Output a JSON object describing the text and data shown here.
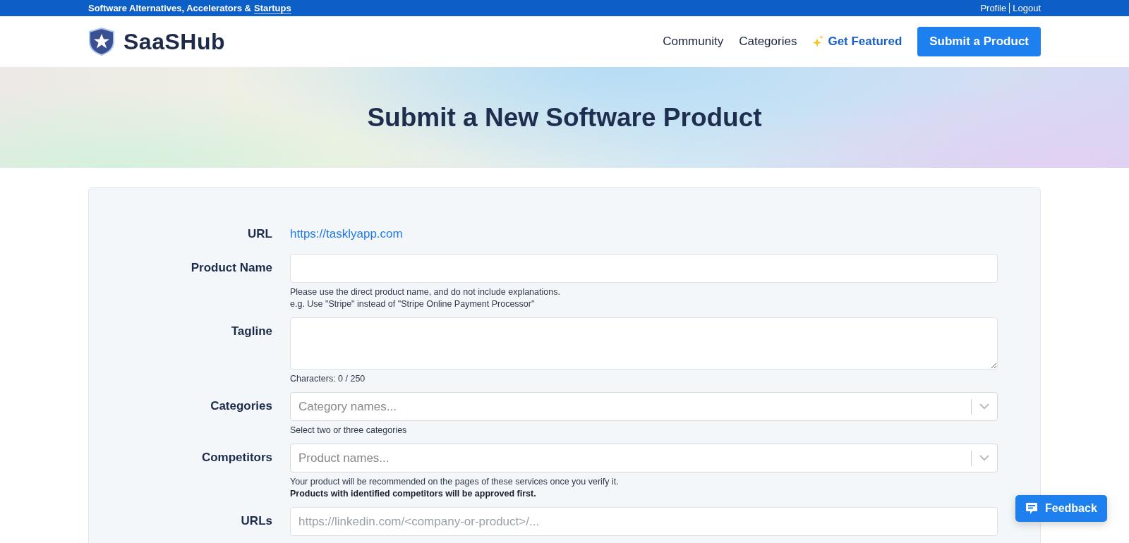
{
  "top_bar": {
    "tagline": "Software Alternatives, Accelerators &",
    "tagline_link": "Startups",
    "user_links": [
      "Profile",
      "Logout"
    ]
  },
  "nav": {
    "logo": "SaaSHub",
    "links": [
      {
        "label": "Community",
        "kind": "plain"
      },
      {
        "label": "Categories",
        "kind": "plain"
      },
      {
        "label": "Get Featured",
        "kind": "featured"
      },
      {
        "label": "Submit a Product",
        "kind": "button"
      }
    ]
  },
  "hero": {
    "title": "Submit a New Software Product"
  },
  "form": {
    "rows": [
      {
        "label": "URL",
        "kind": "link",
        "value": "https://tasklyapp.com",
        "help": []
      },
      {
        "label": "Product Name",
        "kind": "input",
        "help": [
          {
            "text": "Please use the direct product name, and do not include explanations.",
            "bold": false
          },
          {
            "text": "e.g. Use \"Stripe\" instead of \"Stripe Online Payment Processor\"",
            "bold": false
          }
        ]
      },
      {
        "label": "Tagline",
        "kind": "textarea",
        "help": [
          {
            "text": "Characters: 0 / 250",
            "bold": false
          }
        ]
      },
      {
        "label": "Categories",
        "kind": "select",
        "placeholder": "Category names...",
        "help": [
          {
            "text": "Select two or three categories",
            "bold": false
          }
        ]
      },
      {
        "label": "Competitors",
        "kind": "select",
        "placeholder": "Product names...",
        "help": [
          {
            "text": "Your product will be recommended on the pages of these services once you verify it.",
            "bold": false
          },
          {
            "text": "Products with identified competitors will be approved first.",
            "bold": true
          }
        ]
      },
      {
        "label": "URLs",
        "kind": "input",
        "placeholder": "https://linkedin.com/<company-or-product>/...",
        "help": []
      }
    ]
  },
  "feedback": {
    "label": "Feedback"
  }
}
